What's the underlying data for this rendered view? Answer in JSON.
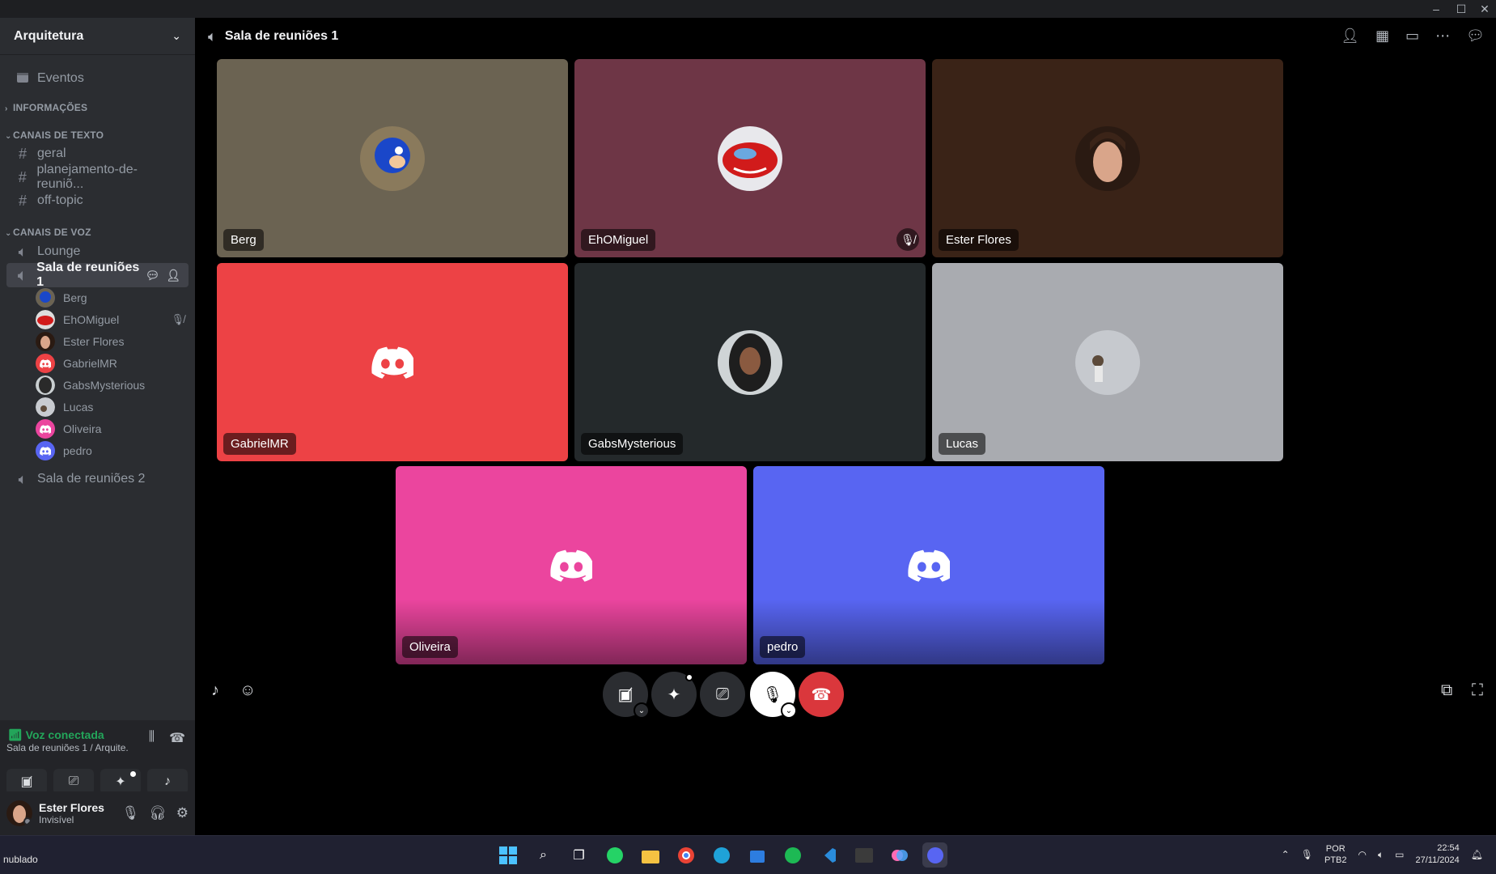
{
  "window": {
    "controls": [
      "–",
      "☐",
      "✕"
    ]
  },
  "sidebar": {
    "server_name": "Arquitetura",
    "events": "Eventos",
    "categories": {
      "info": "INFORMAÇÕES",
      "text": "CANAIS DE TEXTO",
      "voice": "CANAIS DE VOZ"
    },
    "text_channels": [
      "geral",
      "planejamento-de-reuniõ...",
      "off-topic"
    ],
    "voice_channels": [
      "Lounge",
      "Sala de reuniões 1",
      "Sala de reuniões 2"
    ],
    "members": [
      "Berg",
      "EhOMiguel",
      "Ester Flores",
      "GabrielMR",
      "GabsMysterious",
      "Lucas",
      "Oliveira",
      "pedro"
    ]
  },
  "voice_panel": {
    "status": "Voz conectada",
    "location": "Sala de reuniões 1 / Arquite..."
  },
  "user": {
    "name": "Ester Flores",
    "status": "Invisível"
  },
  "header": {
    "channel_name": "Sala de reuniões 1"
  },
  "tiles": [
    {
      "name": "Berg",
      "bg": "#6b6352"
    },
    {
      "name": "EhOMiguel",
      "bg": "#6e3646",
      "muted": true
    },
    {
      "name": "Ester Flores",
      "bg": "#3a2317"
    },
    {
      "name": "GabrielMR",
      "bg": "#ed4245"
    },
    {
      "name": "GabsMysterious",
      "bg": "#24292b"
    },
    {
      "name": "Lucas",
      "bg": "#a9abb0"
    },
    {
      "name": "Oliveira",
      "bg": "#eb459e"
    },
    {
      "name": "pedro",
      "bg": "#5865f2"
    }
  ],
  "taskbar": {
    "weather": "nublado",
    "lang_top": "POR",
    "lang_bottom": "PTB2",
    "time": "22:54",
    "date": "27/11/2024"
  }
}
